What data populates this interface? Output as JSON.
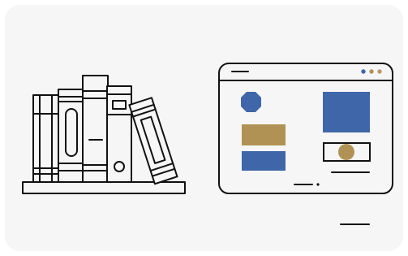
{
  "illustration": {
    "left_scene": "bookshelf-with-books",
    "right_scene": "browser-window-with-shapes"
  },
  "colors": {
    "background": "#f6f6f6",
    "outline": "#111111",
    "blue": "#3f66a8",
    "gold": "#b09354",
    "dot_blue": "#3f66a8",
    "dot_gold": "#b09354",
    "dot_tan": "#c29468"
  },
  "icons": {
    "left": "bookshelf-icon",
    "right": "browser-window-icon"
  }
}
